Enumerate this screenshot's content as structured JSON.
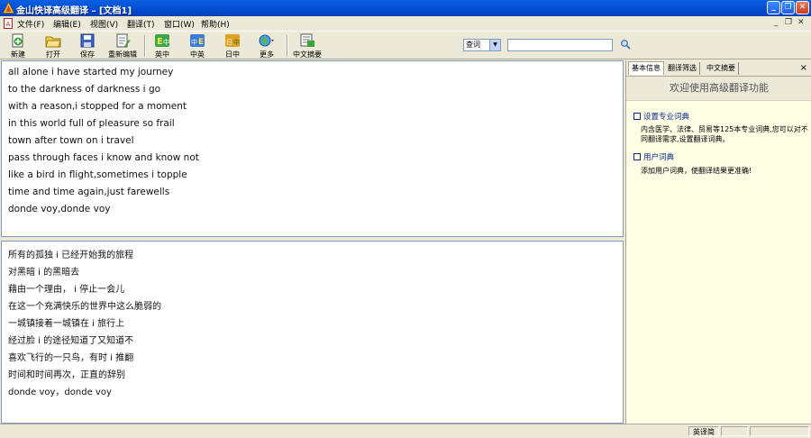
{
  "window": {
    "title": "金山快译高级翻译 – [文档1]"
  },
  "menu": [
    "文件(F)",
    "编辑(E)",
    "视图(V)",
    "翻译(T)",
    "窗口(W)",
    "帮助(H)"
  ],
  "toolbar": {
    "new": "新建",
    "open": "打开",
    "save": "保存",
    "reedit": "重新编辑",
    "en_zh": "英中",
    "zh_en": "中英",
    "ja_zh": "日中",
    "more": "更多",
    "zh_summary": "中文摘要"
  },
  "search": {
    "mode": "查词",
    "value": ""
  },
  "source_lines": [
    "all alone i have started my journey",
    "to the darkness of darkness i go",
    "with a reason,i stopped for a moment",
    "in this world full of pleasure so frail",
    "town after town on i travel",
    "pass through faces i know and know not",
    "like a bird in flight,sometimes i topple",
    "time and time again,just farewells",
    "donde voy,donde voy"
  ],
  "target_lines": [
    "所有的孤独 i 已经开始我的旅程",
    "对黑暗 i 的黑暗去",
    "藉由一个理由， i 停止一会儿",
    "在这一个充满快乐的世界中这么脆弱的",
    "一城镇接着一城镇在 i 旅行上",
    "经过脸 i 的途径知道了又知道不",
    "喜欢飞行的一只鸟，有时 i 推翻",
    "时间和时间再次，正直的辞别",
    "donde voy，donde voy"
  ],
  "side_panel": {
    "tabs": [
      "基本信息",
      "翻译筛选",
      "中文摘要"
    ],
    "welcome": "欢迎使用高级翻译功能",
    "sections": [
      {
        "title": "设置专业词典",
        "text": "内含医学、法律、贸易等125本专业词典,您可以对不同翻译需求,设置翻译词典。"
      },
      {
        "title": "用户词典",
        "text": "添加用户词典，使翻译结果更准确!"
      }
    ]
  },
  "status": {
    "lang": "英译简"
  }
}
